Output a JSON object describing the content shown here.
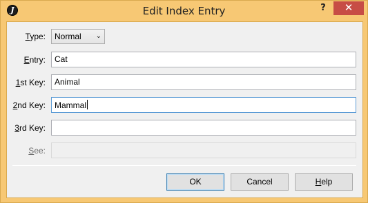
{
  "window": {
    "title": "Edit Index Entry",
    "app_icon_glyph": "J",
    "help_glyph": "?",
    "close_glyph": "✕"
  },
  "form": {
    "type": {
      "label_key": "T",
      "label_rest": "ype:",
      "value": "Normal"
    },
    "entry": {
      "label_key": "E",
      "label_rest": "ntry:",
      "value": "Cat"
    },
    "key1": {
      "label_key": "1",
      "label_rest": "st Key:",
      "value": "Animal"
    },
    "key2": {
      "label_key": "2",
      "label_rest": "nd Key:",
      "value": "Mammal"
    },
    "key3": {
      "label_key": "3",
      "label_rest": "rd Key:",
      "value": ""
    },
    "see": {
      "label_key": "S",
      "label_rest": "ee:",
      "value": ""
    }
  },
  "buttons": {
    "ok": "OK",
    "cancel": "Cancel",
    "help_key": "H",
    "help_rest": "elp"
  },
  "colors": {
    "frame": "#f7c874",
    "close": "#c74d45",
    "focus_border": "#5b9bd5"
  }
}
